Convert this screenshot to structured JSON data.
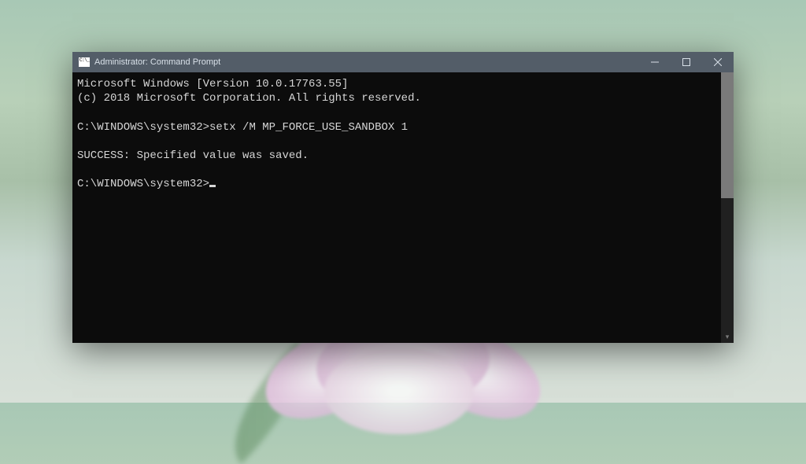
{
  "titlebar": {
    "title": "Administrator: Command Prompt"
  },
  "terminal": {
    "line1": "Microsoft Windows [Version 10.0.17763.55]",
    "line2": "(c) 2018 Microsoft Corporation. All rights reserved.",
    "prompt1_path": "C:\\WINDOWS\\system32>",
    "prompt1_cmd": "setx /M MP_FORCE_USE_SANDBOX 1",
    "result": "SUCCESS: Specified value was saved.",
    "prompt2_path": "C:\\WINDOWS\\system32>"
  }
}
